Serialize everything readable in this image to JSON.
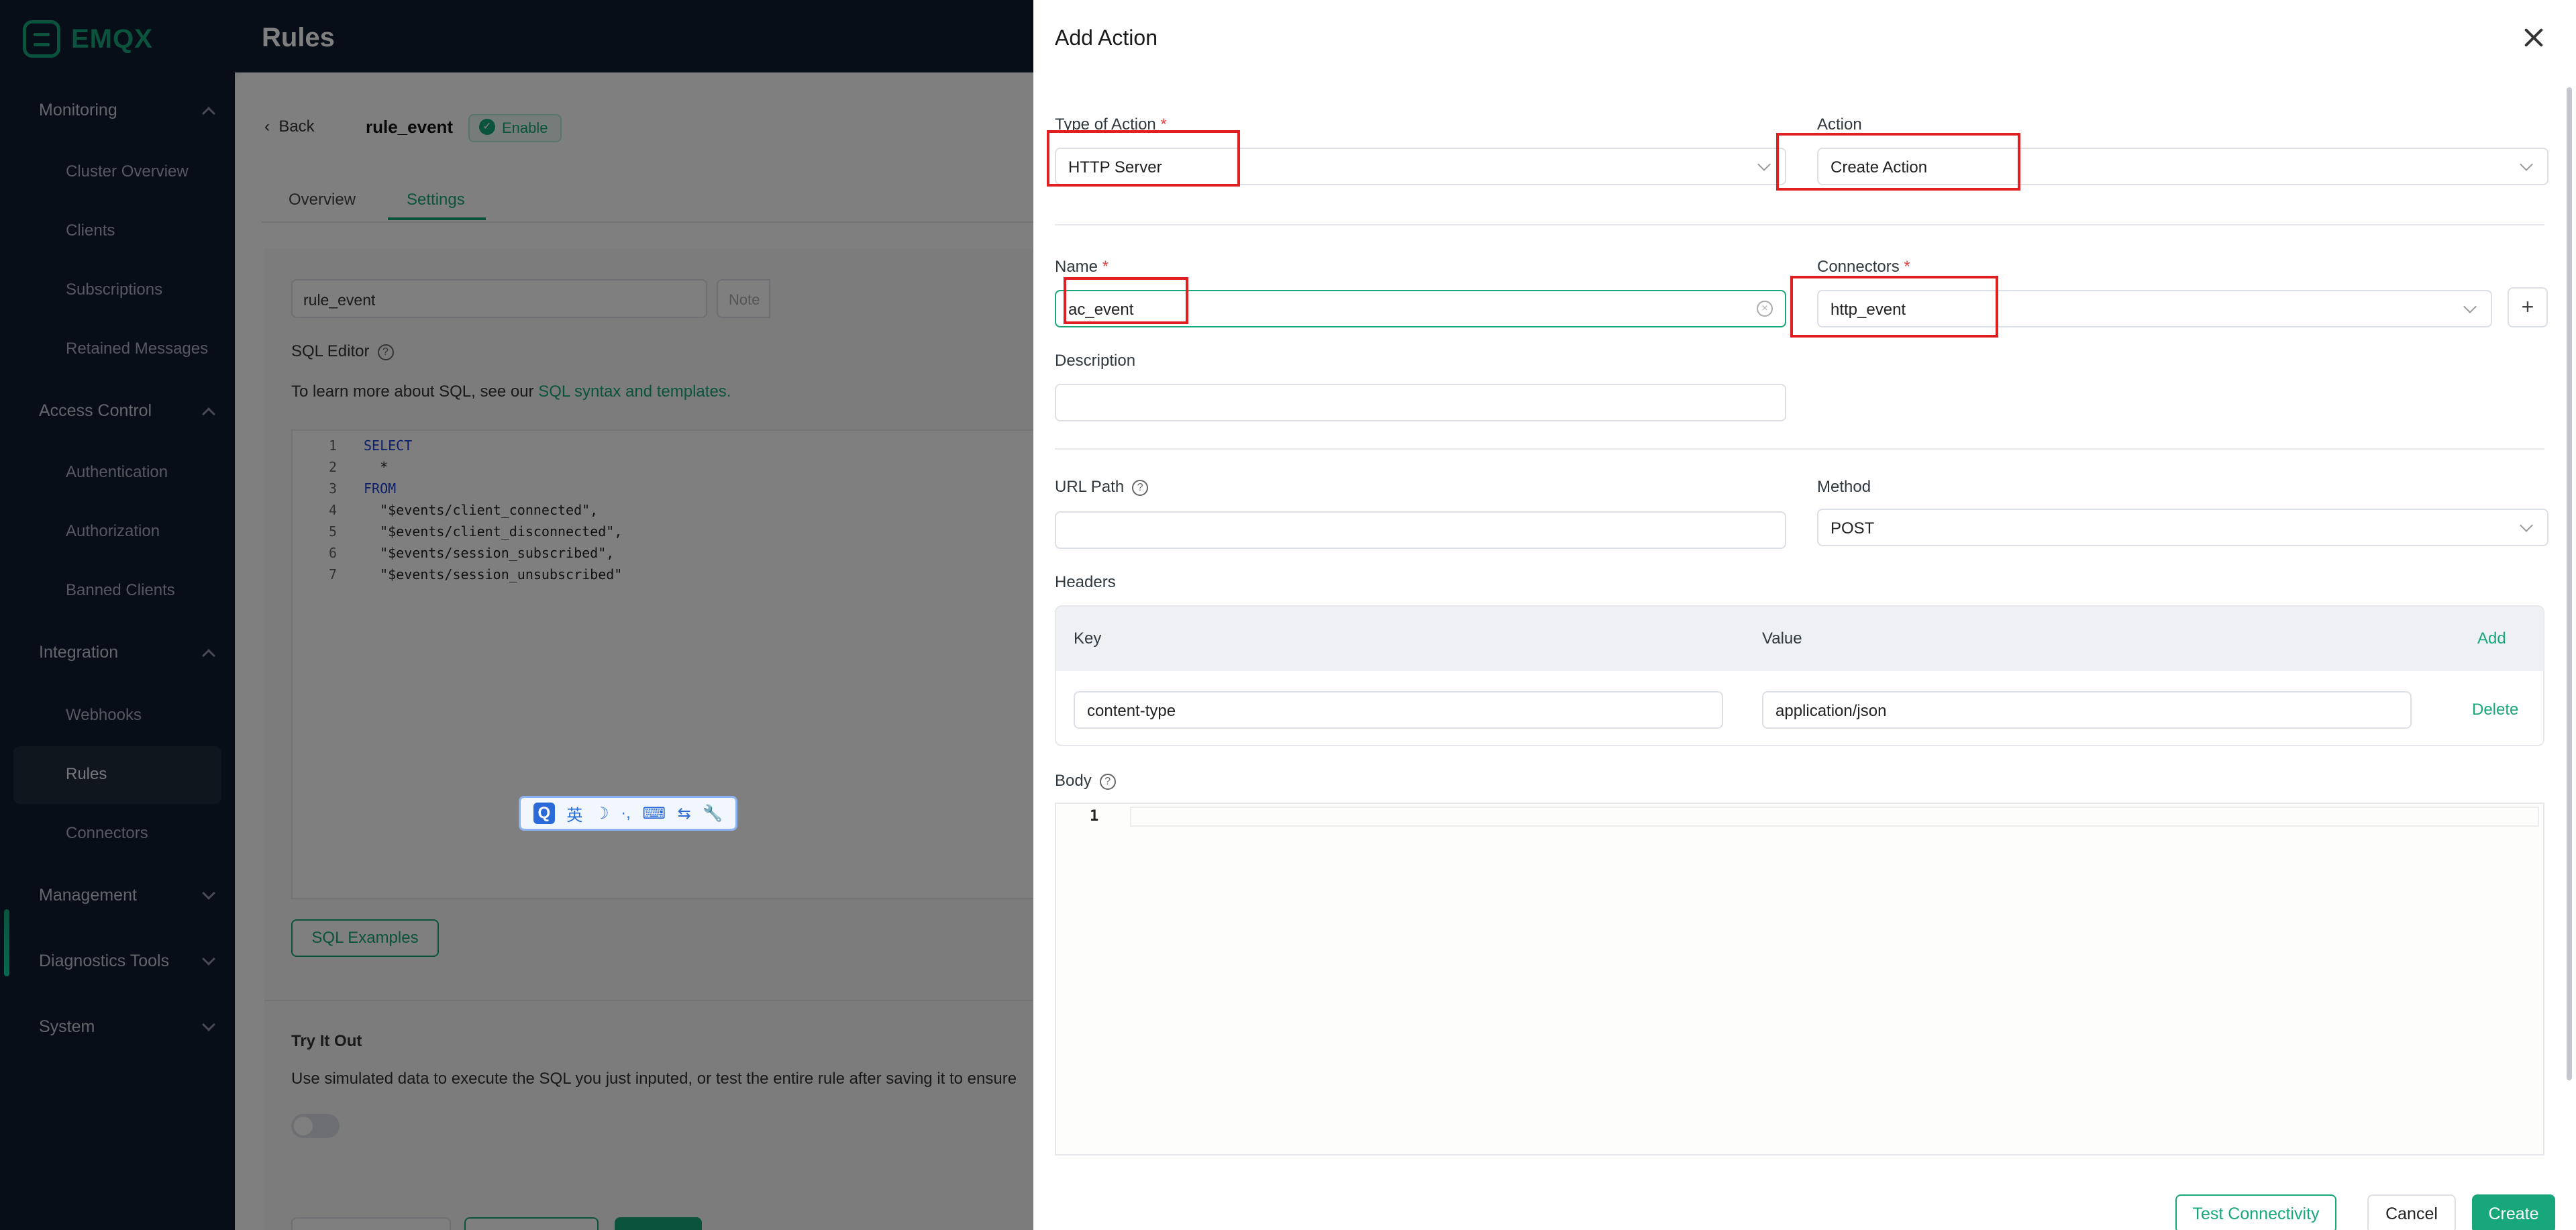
{
  "app": {
    "logo_text": "EMQX"
  },
  "sidebar": {
    "groups": [
      {
        "label": "Monitoring",
        "items": [
          "Cluster Overview",
          "Clients",
          "Subscriptions",
          "Retained Messages"
        ]
      },
      {
        "label": "Access Control",
        "items": [
          "Authentication",
          "Authorization",
          "Banned Clients"
        ]
      },
      {
        "label": "Integration",
        "items": [
          "Webhooks",
          "Rules",
          "Connectors"
        ]
      },
      {
        "label": "Management"
      },
      {
        "label": "Diagnostics Tools"
      },
      {
        "label": "System"
      }
    ],
    "active_item": "Rules"
  },
  "page": {
    "title": "Rules",
    "back_label": "Back",
    "rule_name": "rule_event",
    "enable_label": "Enable",
    "tabs": [
      "Overview",
      "Settings"
    ],
    "active_tab": "Settings",
    "rule_input_value": "rule_event",
    "note_placeholder": "Note",
    "sql_editor_label": "SQL Editor",
    "sql_hint_prefix": "To learn more about SQL, see our ",
    "sql_hint_link": "SQL syntax and templates.",
    "sql_lines": [
      "SELECT",
      "  *",
      "FROM",
      "  \"$events/client_connected\",",
      "  \"$events/client_disconnected\",",
      "  \"$events/session_subscribed\",",
      "  \"$events/session_unsubscribed\""
    ],
    "sql_examples_label": "SQL Examples",
    "try_it_out_label": "Try It Out",
    "try_it_out_desc": "Use simulated data to execute the SQL you just inputed, or test the entire rule after saving it to ensure"
  },
  "ime": {
    "items": [
      "Q",
      "英",
      "☽",
      "·,",
      "⌨",
      "⇆",
      "🔧"
    ]
  },
  "drawer": {
    "title": "Add Action",
    "type_of_action": {
      "label": "Type of Action",
      "value": "HTTP Server"
    },
    "action": {
      "label": "Action",
      "value": "Create Action"
    },
    "name": {
      "label": "Name",
      "value": "ac_event"
    },
    "connectors": {
      "label": "Connectors",
      "value": "http_event"
    },
    "description": {
      "label": "Description",
      "value": ""
    },
    "url_path": {
      "label": "URL Path",
      "value": ""
    },
    "method": {
      "label": "Method",
      "value": "POST"
    },
    "headers": {
      "label": "Headers",
      "col_key": "Key",
      "col_value": "Value",
      "add_label": "Add",
      "rows": [
        {
          "key": "content-type",
          "value": "application/json",
          "delete_label": "Delete"
        }
      ]
    },
    "body": {
      "label": "Body",
      "line_number": "1"
    },
    "buttons": {
      "test": "Test Connectivity",
      "cancel": "Cancel",
      "create": "Create"
    }
  },
  "colors": {
    "accent": "#17a77a",
    "sidebar_bg": "#0f1d2e",
    "annotation_red": "#e02020"
  }
}
